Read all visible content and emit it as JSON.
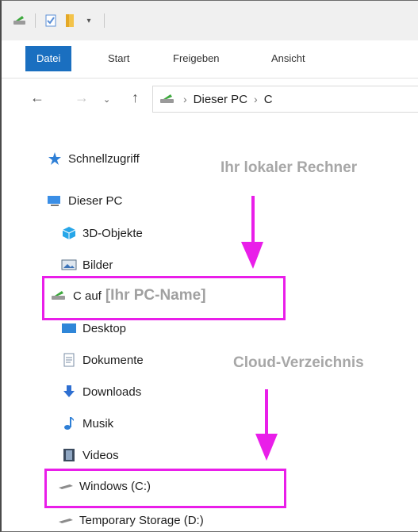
{
  "ribbon": {
    "tabs": [
      "Datei",
      "Start",
      "Freigeben",
      "Ansicht"
    ]
  },
  "address": {
    "segments": [
      "Dieser PC",
      "C"
    ]
  },
  "tree": {
    "quick_access": "Schnellzugriff",
    "this_pc": "Dieser PC",
    "objects3d": "3D-Objekte",
    "pictures": "Bilder",
    "c_on": "C auf",
    "desktop": "Desktop",
    "documents": "Dokumente",
    "downloads": "Downloads",
    "music": "Musik",
    "videos": "Videos",
    "windows_c": "Windows (C:)",
    "temp_d": "Temporary Storage (D:)"
  },
  "annotations": {
    "local_machine": "Ihr lokaler Rechner",
    "pc_name": "[Ihr PC-Name]",
    "cloud_dir": "Cloud-Verzeichnis"
  },
  "colors": {
    "highlight": "#e91ee9",
    "accent": "#1a6fc0"
  }
}
